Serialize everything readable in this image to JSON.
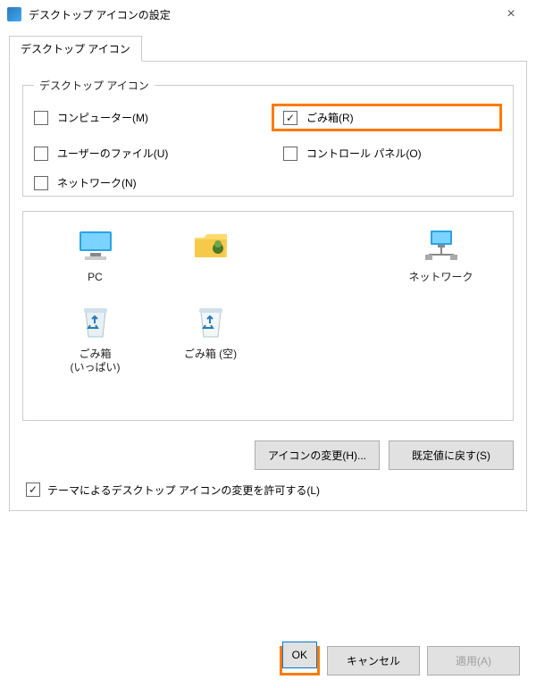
{
  "window": {
    "title": "デスクトップ アイコンの設定"
  },
  "tab": {
    "label": "デスクトップ アイコン"
  },
  "group": {
    "legend": "デスクトップ アイコン",
    "items": {
      "computer": {
        "label": "コンピューター(M)"
      },
      "recyclebin": {
        "label": "ごみ箱(R)"
      },
      "userfiles": {
        "label": "ユーザーのファイル(U)"
      },
      "cpanel": {
        "label": "コントロール パネル(O)"
      },
      "network": {
        "label": "ネットワーク(N)"
      }
    }
  },
  "icons": {
    "pc": {
      "label": "PC"
    },
    "network": {
      "label": "ネットワーク"
    },
    "recyclefull": {
      "label": "ごみ箱\n(いっぱい)"
    },
    "recycleempty": {
      "label": "ごみ箱 (空)"
    }
  },
  "buttons": {
    "change_icon": "アイコンの変更(H)...",
    "restore_default": "既定値に戻す(S)",
    "ok": "OK",
    "cancel": "キャンセル",
    "apply": "適用(A)"
  },
  "theme_checkbox": {
    "label": "テーマによるデスクトップ アイコンの変更を許可する(L)"
  }
}
